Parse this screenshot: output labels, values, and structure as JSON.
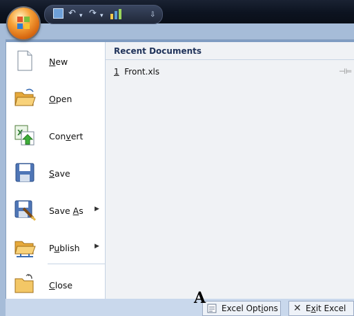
{
  "office_button": {
    "icon": "office-logo-icon"
  },
  "quick_access": {
    "icons": [
      "save-icon",
      "undo-icon",
      "redo-icon",
      "chart-icon",
      "customize-dropdown-icon"
    ]
  },
  "menu": {
    "items": [
      {
        "mnemonic": "N",
        "rest": "ew",
        "icon": "new-document-icon"
      },
      {
        "mnemonic": "O",
        "rest": "pen",
        "icon": "open-folder-icon"
      },
      {
        "before": "Con",
        "mnemonic": "v",
        "rest": "ert",
        "icon": "convert-icon"
      },
      {
        "mnemonic": "S",
        "rest": "ave",
        "icon": "save-icon"
      },
      {
        "before": "Save ",
        "mnemonic": "A",
        "rest": "s",
        "icon": "save-as-icon"
      },
      {
        "before": "P",
        "mnemonic": "u",
        "rest": "blish",
        "icon": "publish-icon"
      },
      {
        "mnemonic": "C",
        "rest": "lose",
        "icon": "close-folder-icon"
      }
    ]
  },
  "recent": {
    "header": "Recent Documents",
    "docs": [
      {
        "num": "1",
        "name": "Front.xls"
      }
    ]
  },
  "bottom": {
    "options_before": "Excel Opt",
    "options_mnemonic": "i",
    "options_rest": "ons",
    "exit_before": "E",
    "exit_mnemonic": "x",
    "exit_rest": "it Excel"
  },
  "annotation": {
    "letter": "A"
  }
}
